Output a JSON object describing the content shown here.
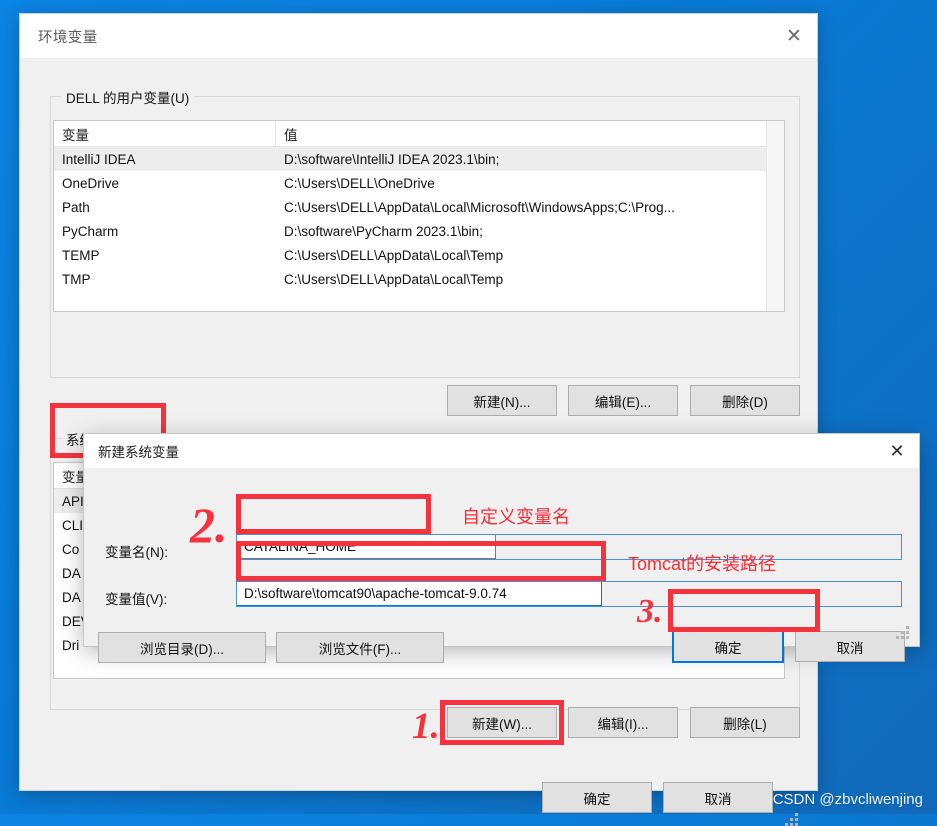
{
  "window": {
    "title": "环境变量",
    "close_icon": "close-icon"
  },
  "user_section": {
    "label": "DELL 的用户变量(U)",
    "columns": [
      "变量",
      "值"
    ],
    "rows": [
      {
        "name": "IntelliJ IDEA",
        "value": "D:\\software\\IntelliJ IDEA 2023.1\\bin;",
        "selected": true
      },
      {
        "name": "OneDrive",
        "value": "C:\\Users\\DELL\\OneDrive",
        "selected": false
      },
      {
        "name": "Path",
        "value": "C:\\Users\\DELL\\AppData\\Local\\Microsoft\\WindowsApps;C:\\Prog...",
        "selected": false
      },
      {
        "name": "PyCharm",
        "value": "D:\\software\\PyCharm 2023.1\\bin;",
        "selected": false
      },
      {
        "name": "TEMP",
        "value": "C:\\Users\\DELL\\AppData\\Local\\Temp",
        "selected": false
      },
      {
        "name": "TMP",
        "value": "C:\\Users\\DELL\\AppData\\Local\\Temp",
        "selected": false
      }
    ],
    "buttons": {
      "new": "新建(N)...",
      "edit": "编辑(E)...",
      "delete": "删除(D)"
    }
  },
  "system_section": {
    "label": "系统变量(S)",
    "columns": [
      "变量"
    ],
    "rows": [
      {
        "name": "API"
      },
      {
        "name": "CLI"
      },
      {
        "name": "Co"
      },
      {
        "name": "DA"
      },
      {
        "name": "DA"
      },
      {
        "name": "DEV"
      },
      {
        "name": "Dri"
      }
    ],
    "buttons": {
      "new": "新建(W)...",
      "edit": "编辑(I)...",
      "delete": "删除(L)"
    }
  },
  "footer": {
    "ok": "确定",
    "cancel": "取消"
  },
  "new_variable_dialog": {
    "title": "新建系统变量",
    "close_icon": "close-icon",
    "name_label": "变量名(N):",
    "name_value": "CATALINA_HOME",
    "value_label": "变量值(V):",
    "value_value": "D:\\software\\tomcat90\\apache-tomcat-9.0.74",
    "browse_dir": "浏览目录(D)...",
    "browse_file": "浏览文件(F)...",
    "ok": "确定",
    "cancel": "取消"
  },
  "annotations": {
    "marker_1": "1.",
    "marker_2": "2.",
    "marker_3": "3.",
    "note_name": "自定义变量名",
    "note_value": "Tomcat的安装路径",
    "accent_red": "#f5333f",
    "accent_blue": "#0078d7"
  },
  "watermark": "CSDN @zbvcliwenjing"
}
